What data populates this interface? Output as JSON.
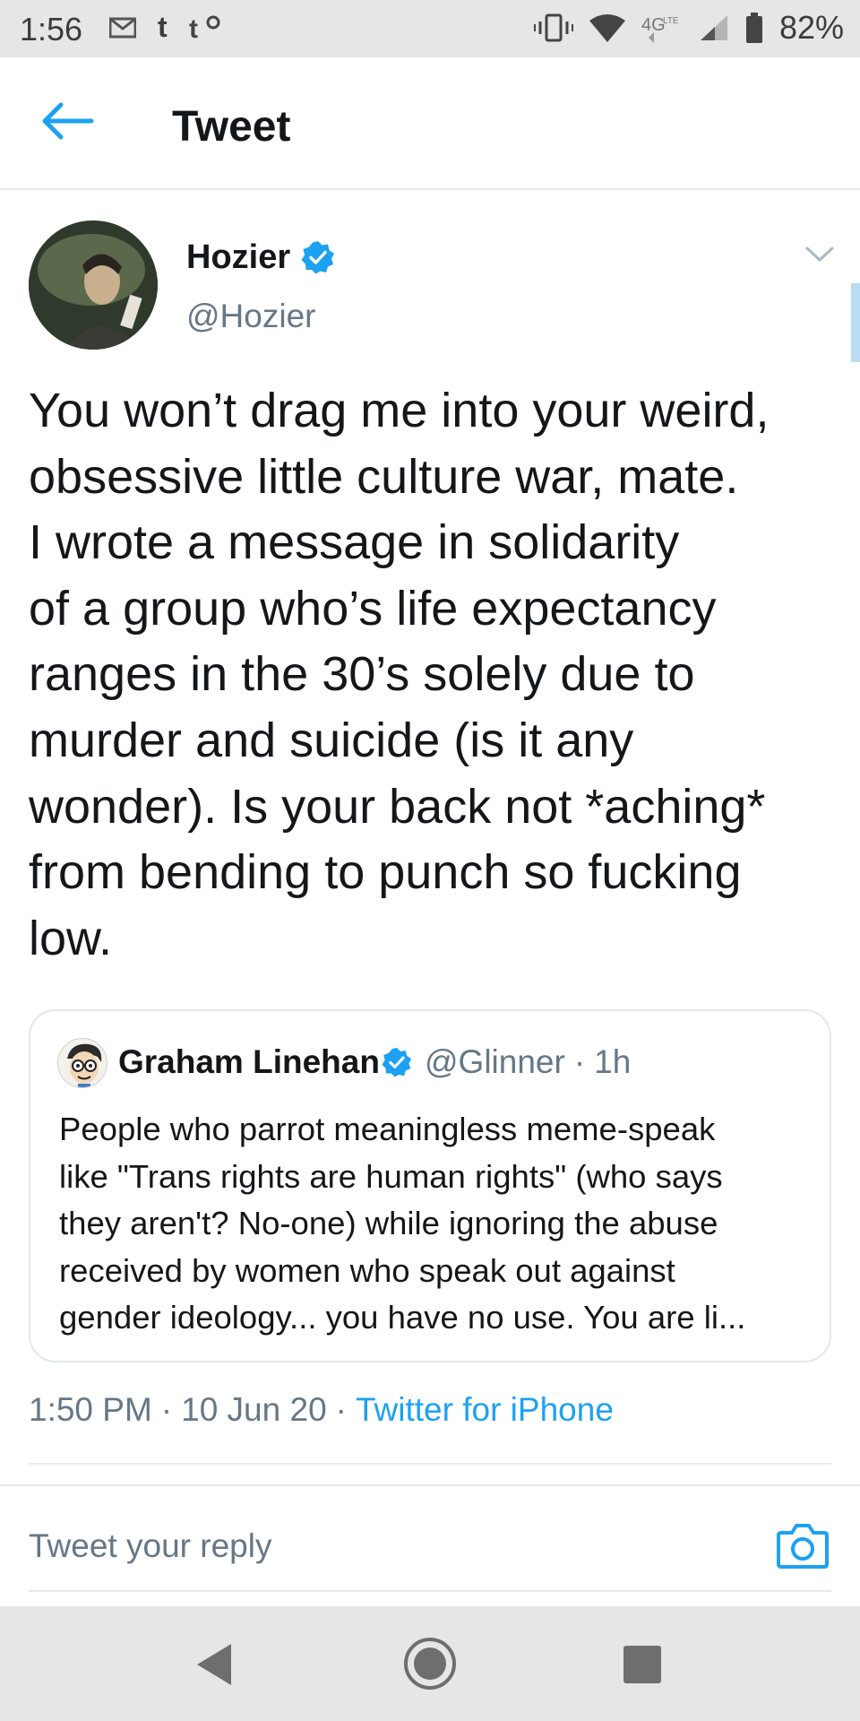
{
  "status_bar": {
    "time": "1:56",
    "left_icons": [
      "mail-icon",
      "tumblr-icon",
      "tumblr-settings-icon"
    ],
    "right_icons": [
      "vibrate-icon",
      "wifi-icon",
      "4g-lte-icon",
      "signal-icon",
      "battery-icon"
    ],
    "battery": "82%"
  },
  "app_bar": {
    "title": "Tweet"
  },
  "tweet": {
    "author_name": "Hozier",
    "author_handle": "@Hozier",
    "text": "You won’t drag me into your weird,\nobsessive little culture war, mate.\nI wrote a message in solidarity\nof a group who’s life expectancy\nranges in the 30’s solely due to\nmurder and suicide (is it any\nwonder). Is your back not *aching*\nfrom bending to punch so fucking\nlow.",
    "time": "1:50 PM",
    "date": "10 Jun 20",
    "source": "Twitter for iPhone"
  },
  "quote": {
    "author_name": "Graham Linehan",
    "author_handle": "@Glinner",
    "age": "1h",
    "text": "People who parrot meaningless meme-speak\nlike \"Trans rights are human rights\" (who says\nthey aren't? No-one) while ignoring the abuse\nreceived by women who speak out against\ngender ideology... you have no use. You are li..."
  },
  "reply": {
    "placeholder": "Tweet your reply"
  },
  "colors": {
    "accent": "#1da1f2",
    "secondary_text": "#657786",
    "primary_text": "#14171a",
    "system_bar": "#e6e6e6"
  },
  "separator": "·"
}
